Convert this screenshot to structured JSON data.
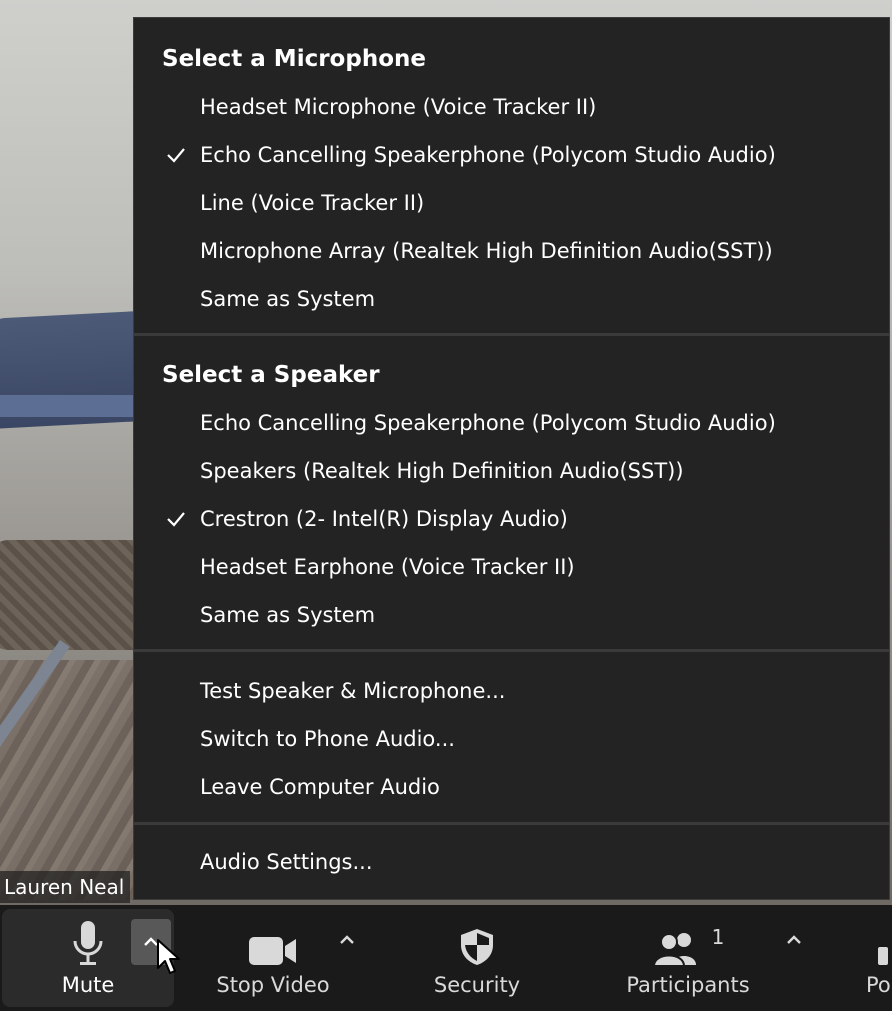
{
  "video": {
    "participant_name": "Lauren Neal"
  },
  "audio_menu": {
    "microphone_section": {
      "title": "Select a Microphone",
      "items": [
        {
          "label": "Headset Microphone (Voice Tracker II)",
          "checked": false
        },
        {
          "label": "Echo Cancelling Speakerphone (Polycom Studio Audio)",
          "checked": true
        },
        {
          "label": "Line (Voice Tracker II)",
          "checked": false
        },
        {
          "label": "Microphone Array (Realtek High Definition Audio(SST))",
          "checked": false
        },
        {
          "label": "Same as System",
          "checked": false
        }
      ]
    },
    "speaker_section": {
      "title": "Select a Speaker",
      "items": [
        {
          "label": "Echo Cancelling Speakerphone (Polycom Studio Audio)",
          "checked": false
        },
        {
          "label": "Speakers (Realtek High Definition Audio(SST))",
          "checked": false
        },
        {
          "label": "Crestron (2- Intel(R) Display Audio)",
          "checked": true
        },
        {
          "label": "Headset Earphone (Voice Tracker II)",
          "checked": false
        },
        {
          "label": "Same as System",
          "checked": false
        }
      ]
    },
    "actions": [
      {
        "label": "Test Speaker & Microphone..."
      },
      {
        "label": "Switch to Phone Audio..."
      },
      {
        "label": "Leave Computer Audio"
      }
    ],
    "settings": {
      "label": "Audio Settings..."
    }
  },
  "toolbar": {
    "mute_label": "Mute",
    "stop_video_label": "Stop Video",
    "security_label": "Security",
    "participants_label": "Participants",
    "participants_count": "1",
    "overflow_label": "Po"
  },
  "colors": {
    "menu_bg": "#232323",
    "toolbar_bg": "#1a1a1a",
    "text": "#ffffff",
    "toolbar_text": "#d9d9d9"
  }
}
